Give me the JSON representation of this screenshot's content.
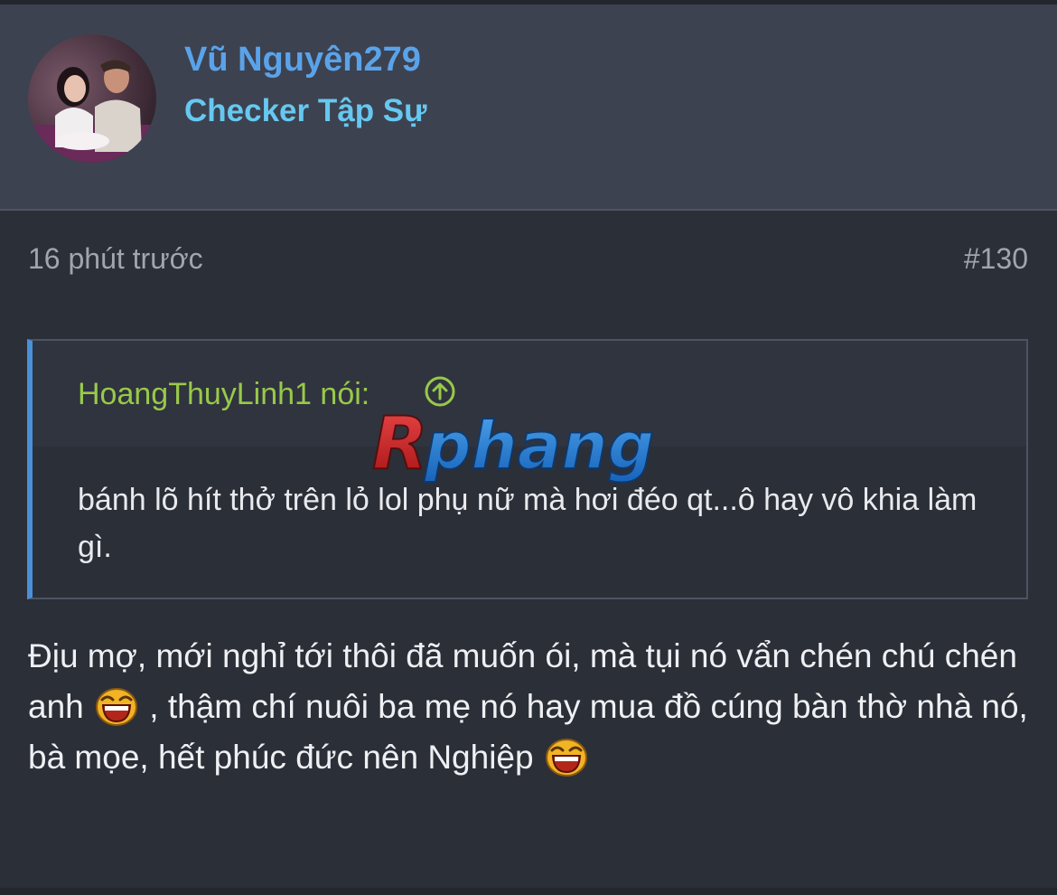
{
  "user": {
    "name": "Vũ Nguyên279",
    "title": "Checker Tập Sự"
  },
  "post": {
    "time": "16 phút trước",
    "number": "#130"
  },
  "quote": {
    "author_line": "HoangThuyLinh1 nói:",
    "body": "bánh lõ hít thở trên lỏ lol phụ nữ mà hơi đéo qt...ô hay vô khia làm gì."
  },
  "message": {
    "line1_part1": "Địu mợ, mới nghỉ tới thôi đã muốn ói, mà tụi nó vẩn chén chú chén anh",
    "line1_part2": ", thậm chí nuôi ba mẹ nó hay mua đồ cúng bàn thờ nhà nó,",
    "line2": "bà mọe, hết phúc đức nên Nghiệp"
  },
  "watermark": {
    "text": "Rphang"
  },
  "colors": {
    "background": "#2b2f38",
    "header": "#3d4250",
    "username": "#5aa3ea",
    "user_title": "#66c8f0",
    "quote_author": "#98c94a",
    "quote_border": "#4a90d9"
  },
  "icons": {
    "quote_jump": "arrow-up-circle-icon",
    "emoji": "laughing-emoji-icon"
  }
}
